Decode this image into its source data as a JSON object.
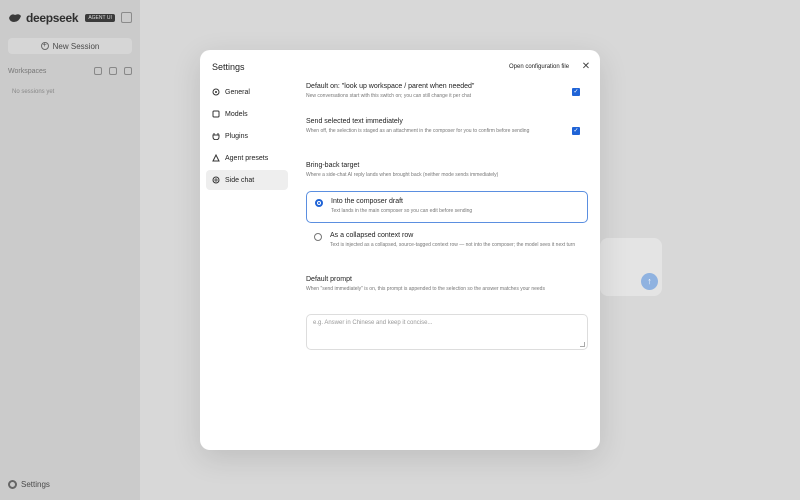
{
  "app": {
    "brand": "deepseek",
    "badge": "AGENT UI",
    "new_session_label": "New Session",
    "workspaces_label": "Workspaces",
    "no_sessions": "No sessions yet",
    "settings_label": "Settings"
  },
  "modal": {
    "title": "Settings",
    "open_config_label": "Open configuration file",
    "nav": [
      {
        "label": "General",
        "icon": "gear-icon"
      },
      {
        "label": "Models",
        "icon": "cube-icon"
      },
      {
        "label": "Plugins",
        "icon": "plug-icon"
      },
      {
        "label": "Agent presets",
        "icon": "robot-icon"
      },
      {
        "label": "Side chat",
        "icon": "chat-icon",
        "active": true
      }
    ],
    "settings": {
      "default_on": {
        "title": "Default on: \"look up workspace / parent when needed\"",
        "desc": "New conversations start with this switch on; you can still change it per chat",
        "checked": true
      },
      "send_immediately": {
        "title": "Send selected text immediately",
        "desc": "When off, the selection is staged as an attachment in the composer for you to confirm before sending",
        "checked": true
      },
      "bring_back": {
        "title": "Bring-back target",
        "desc": "Where a side-chat AI reply lands when brought back (neither mode sends immediately)",
        "options": [
          {
            "title": "Into the composer draft",
            "desc": "Text lands in the main composer so you can edit before sending",
            "selected": true
          },
          {
            "title": "As a collapsed context row",
            "desc": "Text is injected as a collapsed, source-tagged context row — not into the composer; the model sees it next turn",
            "selected": false
          }
        ]
      },
      "default_prompt": {
        "title": "Default prompt",
        "desc": "When \"send immediately\" is on, this prompt is appended to the selection so the answer matches your needs",
        "placeholder": "e.g. Answer in Chinese and keep it concise..."
      }
    }
  },
  "colors": {
    "accent": "#1f63d6",
    "overlay": "#d8d8d8"
  }
}
